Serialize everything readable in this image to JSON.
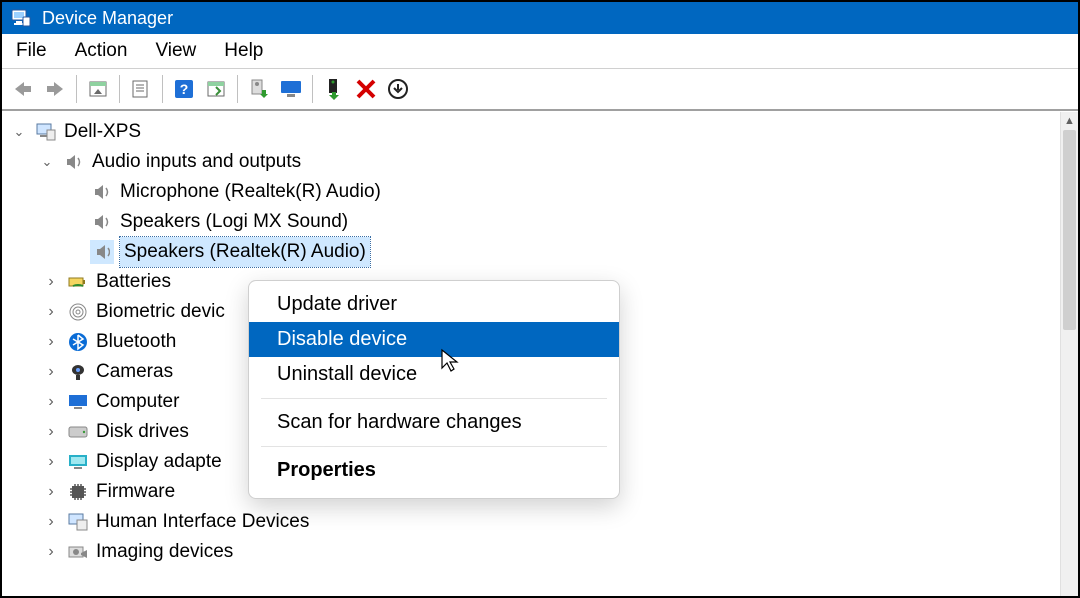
{
  "window": {
    "title": "Device Manager"
  },
  "menu": {
    "file": "File",
    "action": "Action",
    "view": "View",
    "help": "Help"
  },
  "tree": {
    "root": "Dell-XPS",
    "audio": {
      "label": "Audio inputs and outputs",
      "items": [
        "Microphone (Realtek(R) Audio)",
        "Speakers (Logi MX Sound)",
        "Speakers (Realtek(R) Audio)"
      ],
      "selected_index": 2
    },
    "categories": [
      "Batteries",
      "Biometric devic",
      "Bluetooth",
      "Cameras",
      "Computer",
      "Disk drives",
      "Display adapte",
      "Firmware",
      "Human Interface Devices",
      "Imaging devices"
    ]
  },
  "context_menu": {
    "update": "Update driver",
    "disable": "Disable device",
    "uninstall": "Uninstall device",
    "scan": "Scan for hardware changes",
    "properties": "Properties",
    "hover_key": "disable"
  }
}
